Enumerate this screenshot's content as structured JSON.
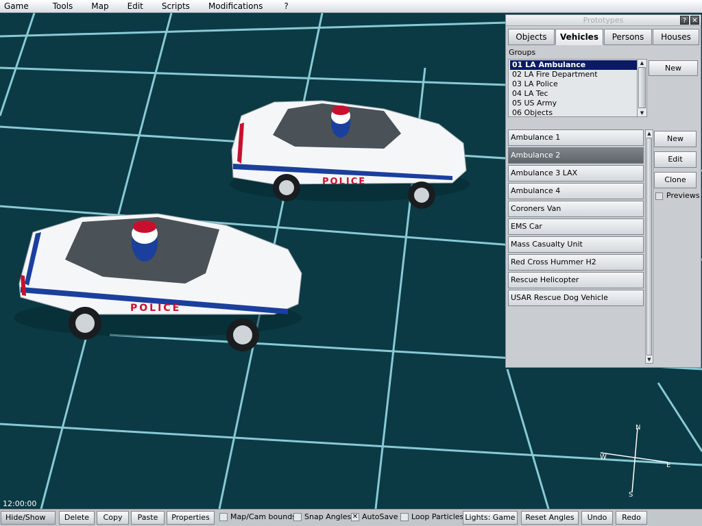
{
  "menu": [
    "Game",
    "Tools",
    "Map",
    "Edit",
    "Scripts",
    "Modifications",
    "?"
  ],
  "colors": {
    "grid_bg": "#0b3a44",
    "grid_line": "#9fe4ee",
    "selection": "#0c1a66",
    "car_body": "#ffffff",
    "car_stripe_red": "#c8102e",
    "car_stripe_blue": "#1b3f9c"
  },
  "viewport": {
    "clock": "12:00:00",
    "compass": {
      "n": "N",
      "s": "S",
      "e": "E",
      "w": "W"
    },
    "car_decal": "POLICE"
  },
  "prototypes": {
    "title": "Prototypes",
    "help_icon": "?",
    "close_icon": "close-icon",
    "tabs": [
      {
        "label": "Objects",
        "active": false
      },
      {
        "label": "Vehicles",
        "active": true
      },
      {
        "label": "Persons",
        "active": false
      },
      {
        "label": "Houses",
        "active": false
      }
    ],
    "groups_label": "Groups",
    "groups": [
      "01 LA Ambulance",
      "02 LA Fire Department",
      "03 LA Police",
      "04 LA Tec",
      "05 US Army",
      "06 Objects"
    ],
    "selected_group": 0,
    "new_group_label": "New",
    "items": [
      "Ambulance 1",
      "Ambulance 2",
      "Ambulance 3 LAX",
      "Ambulance 4",
      "Coroners Van",
      "EMS Car",
      "Mass Casualty Unit",
      "Red Cross Hummer H2",
      "Rescue Helicopter",
      "USAR Rescue Dog Vehicle"
    ],
    "selected_item": 1,
    "buttons": {
      "new": "New",
      "edit": "Edit",
      "clone": "Clone"
    },
    "previews_label": "Previews",
    "previews_checked": false
  },
  "toolbar": {
    "hide_show": "Hide/Show",
    "delete": "Delete",
    "copy": "Copy",
    "paste": "Paste",
    "properties": "Properties",
    "map_cam_bounds": "Map/Cam bounds",
    "map_cam_bounds_checked": false,
    "snap_angles": "Snap Angles",
    "snap_angles_checked": false,
    "autosave": "AutoSave",
    "autosave_checked": true,
    "loop_particles": "Loop Particles",
    "loop_particles_checked": false,
    "lights": "Lights: Game",
    "reset_angles": "Reset Angles",
    "undo": "Undo",
    "redo": "Redo"
  }
}
